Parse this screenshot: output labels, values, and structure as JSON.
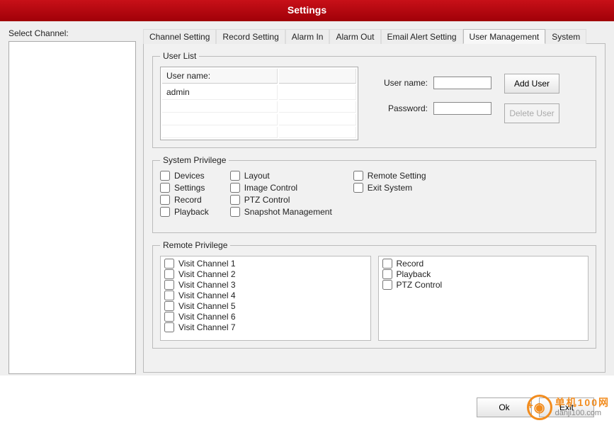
{
  "header": {
    "title": "Settings"
  },
  "left": {
    "label": "Select Channel:"
  },
  "tabs": [
    {
      "label": "Channel Setting"
    },
    {
      "label": "Record Setting"
    },
    {
      "label": "Alarm In"
    },
    {
      "label": "Alarm Out"
    },
    {
      "label": "Email Alert Setting"
    },
    {
      "label": "User Management"
    },
    {
      "label": "System"
    }
  ],
  "active_tab": 5,
  "user_list": {
    "legend": "User List",
    "col_header": "User name:",
    "rows": [
      "admin",
      "",
      "",
      ""
    ],
    "username_label": "User name:",
    "password_label": "Password:",
    "username_value": "",
    "password_value": "",
    "add_user_label": "Add User",
    "delete_user_label": "Delete User"
  },
  "system_privilege": {
    "legend": "System Privilege",
    "col1": [
      "Devices",
      "Settings",
      "Record",
      "Playback"
    ],
    "col2": [
      "Layout",
      "Image Control",
      "PTZ Control",
      "Snapshot Management"
    ],
    "col3": [
      "Remote Setting",
      "Exit System"
    ]
  },
  "remote_privilege": {
    "legend": "Remote Privilege",
    "left_items": [
      "Visit Channel 1",
      "Visit Channel 2",
      "Visit Channel 3",
      "Visit Channel 4",
      "Visit Channel 5",
      "Visit Channel 6",
      "Visit Channel 7"
    ],
    "right_items": [
      "Record",
      "Playback",
      "PTZ Control"
    ]
  },
  "footer": {
    "ok_label": "Ok",
    "exit_label": "Exit"
  },
  "watermark": {
    "cn": "单机100网",
    "url": "danji100.com"
  }
}
